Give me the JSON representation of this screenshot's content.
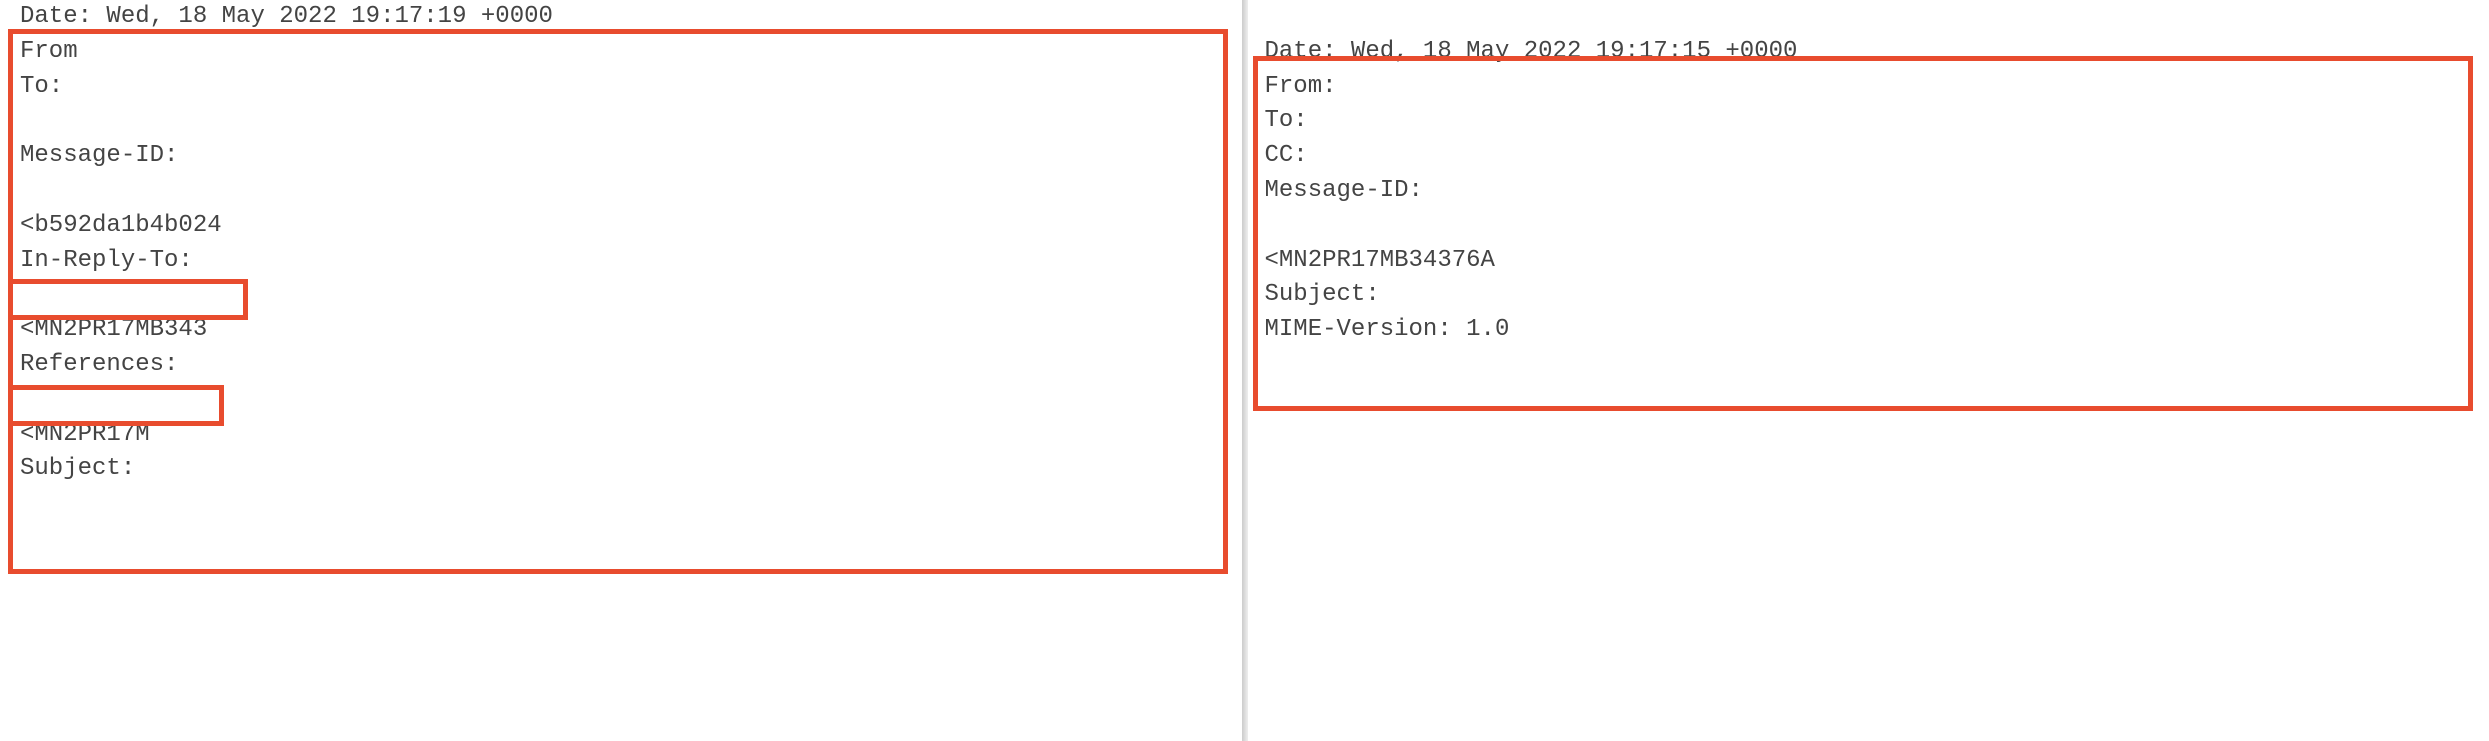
{
  "left": {
    "date_label": "Date:",
    "date_value": "Wed, 18 May 2022 19:17:19 +0000",
    "from_label": "From",
    "to_label": "To:",
    "messageid_label": "Message-ID:",
    "messageid_frag": "<b592da1b4b024",
    "inreplyto_label": "In-Reply-To:",
    "inreplyto_frag": "<MN2PR17MB343",
    "references_label": "References:",
    "references_frag": "<MN2PR17M",
    "subject_label": "Subject:"
  },
  "right": {
    "date_label": "Date:",
    "date_value": "Wed, 18 May 2022 19:17:15 +0000",
    "from_label": "From:",
    "to_label": "To:",
    "cc_label": "CC:",
    "messageid_label": "Message-ID:",
    "messageid_frag": "<MN2PR17MB34376A",
    "subject_label": "Subject:",
    "mime_label": "MIME-Version:",
    "mime_value": "1.0"
  },
  "highlight_color": "#e84c2e"
}
